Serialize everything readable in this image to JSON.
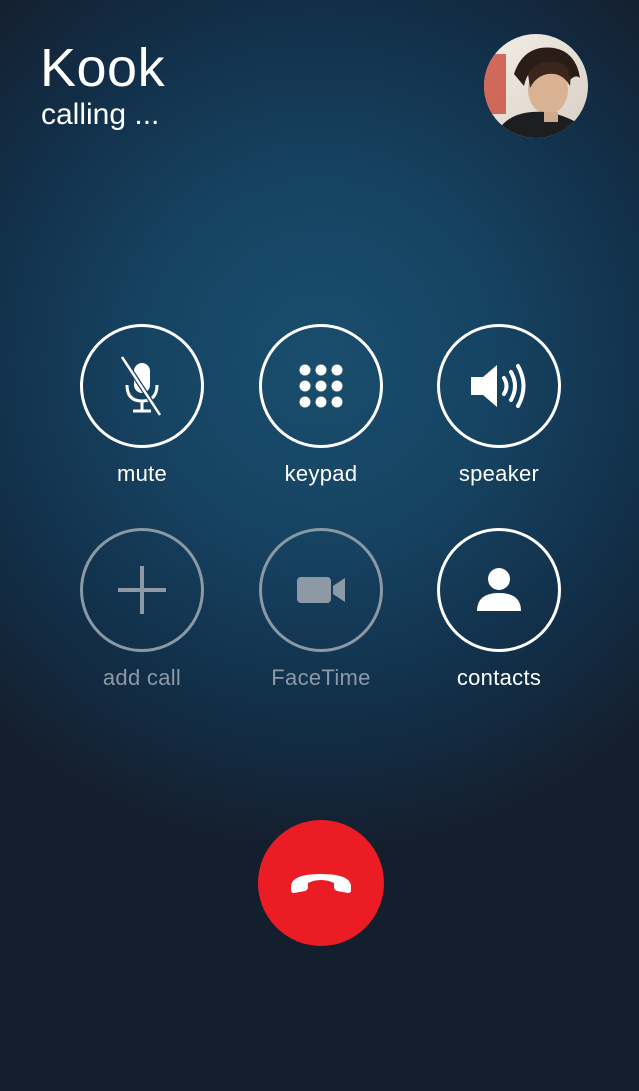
{
  "caller": {
    "name": "Kook",
    "status": "calling ..."
  },
  "controls": {
    "row1": [
      {
        "label": "mute",
        "icon": "mic-off-icon"
      },
      {
        "label": "keypad",
        "icon": "keypad-icon"
      },
      {
        "label": "speaker",
        "icon": "speaker-icon"
      }
    ],
    "row2": [
      {
        "label": "add call",
        "icon": "plus-icon",
        "enabled": false
      },
      {
        "label": "FaceTime",
        "icon": "video-camera-icon",
        "enabled": false
      },
      {
        "label": "contacts",
        "icon": "person-icon",
        "enabled": true
      }
    ]
  },
  "end_call": {
    "icon": "phone-hangup-icon"
  },
  "colors": {
    "background": "#164463",
    "end_call": "#eb1c24",
    "disabled": "#8d9aa6",
    "foreground": "#ffffff"
  }
}
